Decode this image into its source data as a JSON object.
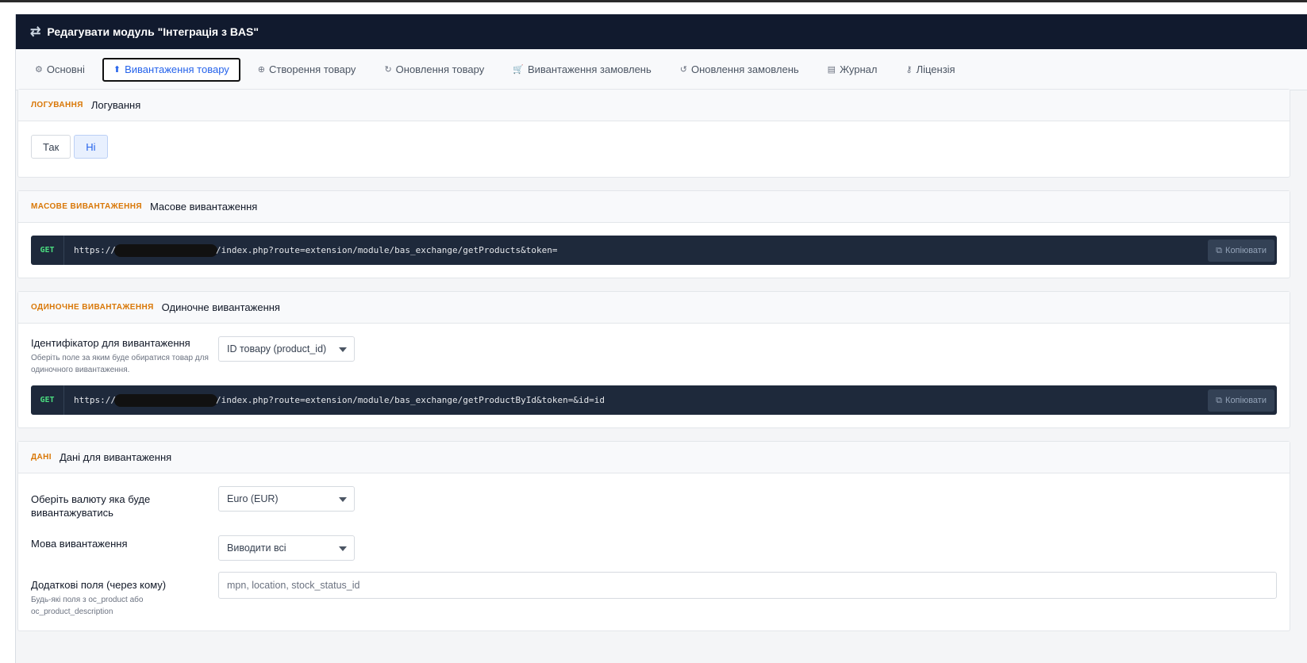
{
  "window": {
    "title": "Редагувати модуль \"Інтеграція з BAS\""
  },
  "tabs": [
    {
      "label": "Основні",
      "icon": "gear-icon"
    },
    {
      "label": "Вивантаження товару",
      "icon": "upload-icon",
      "active": true
    },
    {
      "label": "Створення товару",
      "icon": "plus-circle-icon"
    },
    {
      "label": "Оновлення товару",
      "icon": "refresh-icon"
    },
    {
      "label": "Вивантаження замовлень",
      "icon": "cart-icon"
    },
    {
      "label": "Оновлення замовлень",
      "icon": "history-icon"
    },
    {
      "label": "Журнал",
      "icon": "file-icon"
    },
    {
      "label": "Ліцензія",
      "icon": "key-icon"
    }
  ],
  "logging": {
    "kicker": "ЛОГУВАННЯ",
    "title": "Логування",
    "yes_label": "Так",
    "no_label": "Ні",
    "selected": "Ні"
  },
  "bulk": {
    "kicker": "МАСОВЕ ВИВАНТАЖЕННЯ",
    "title": "Масове вивантаження",
    "method": "GET",
    "url_prefix": "https://",
    "url_suffix": "/index.php?route=extension/module/bas_exchange/getProducts&token=",
    "copy_label": "Копіювати"
  },
  "single": {
    "kicker": "ОДИНОЧНЕ ВИВАНТАЖЕННЯ",
    "title": "Одиночне вивантаження",
    "field_label": "Ідентифікатор для вивантаження",
    "field_help": "Оберіть поле за яким буде обиратися товар для одиночного вивантаження.",
    "field_value": "ID товару (product_id)",
    "method": "GET",
    "url_prefix": "https://",
    "url_suffix": "/index.php?route=extension/module/bas_exchange/getProductById&token=&id=id",
    "copy_label": "Копіювати"
  },
  "data": {
    "kicker": "ДАНІ",
    "title": "Дані для вивантаження",
    "currency_label": "Оберіть валюту яка буде вивантажуватись",
    "currency_value": "Euro (EUR)",
    "language_label": "Мова вивантаження",
    "language_value": "Виводити всі",
    "extra_label": "Додаткові поля (через кому)",
    "extra_help": "Будь-які поля з oc_product або oc_product_description",
    "extra_placeholder": "mpn, location, stock_status_id"
  },
  "colors": {
    "header_bg": "#111a2e",
    "kicker": "#d97706",
    "accent": "#2563eb",
    "endpoint_bg": "#1e293b",
    "method": "#4ade80"
  }
}
